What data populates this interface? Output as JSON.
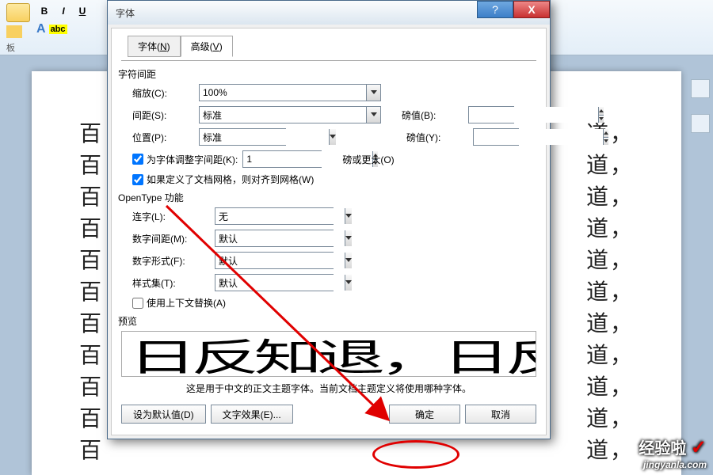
{
  "ribbon": {
    "bold": "B",
    "italic": "I",
    "underline": "U",
    "a_outline": "A",
    "highlight": "abc",
    "panel_label": "板"
  },
  "bg_line_left": "百",
  "bg_line_right": "道，",
  "dialog": {
    "title": "字体",
    "help": "?",
    "close": "X",
    "tabs": {
      "font": "字体(N)",
      "font_key": "N",
      "advanced": "高级(V)",
      "advanced_key": "V"
    },
    "section_spacing": "字符间距",
    "scale_label": "缩放(C):",
    "scale_value": "100%",
    "spacing_label": "间距(S):",
    "spacing_value": "标准",
    "pt_b_label": "磅值(B):",
    "pt_b_value": "",
    "position_label": "位置(P):",
    "position_value": "标准",
    "pt_y_label": "磅值(Y):",
    "pt_y_value": "",
    "kerning_chk": "为字体调整字间距(K):",
    "kerning_val": "1",
    "kerning_unit": "磅或更大(O)",
    "snap_chk": "如果定义了文档网格，则对齐到网格(W)",
    "section_opentype": "OpenType 功能",
    "ligature_label": "连字(L):",
    "ligature_value": "无",
    "numspace_label": "数字间距(M):",
    "numspace_value": "默认",
    "numform_label": "数字形式(F):",
    "numform_value": "默认",
    "styleset_label": "样式集(T):",
    "styleset_value": "默认",
    "context_chk": "使用上下文替换(A)",
    "section_preview": "预览",
    "preview_text": "日反知退，日反",
    "preview_desc": "这是用于中文的正文主题字体。当前文档主题定义将使用哪种字体。",
    "btn_default": "设为默认值(D)",
    "btn_effects": "文字效果(E)...",
    "btn_ok": "确定",
    "btn_cancel": "取消"
  },
  "watermark": {
    "line1": "经验啦",
    "line2": "jingyanla.com"
  }
}
